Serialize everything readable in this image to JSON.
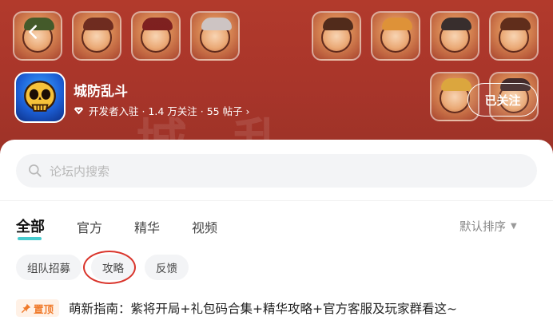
{
  "header": {
    "game_name": "城防乱斗",
    "meta": "开发者入驻 · 1.4 万关注 · 55 帖子 ›",
    "follow_label": "已关注",
    "bg_color": "#a8352a"
  },
  "search": {
    "placeholder": "论坛内搜索"
  },
  "tabs": [
    {
      "label": "全部",
      "active": true
    },
    {
      "label": "官方",
      "active": false
    },
    {
      "label": "精华",
      "active": false
    },
    {
      "label": "视频",
      "active": false
    }
  ],
  "sort": {
    "label": "默认排序"
  },
  "chips": [
    {
      "label": "组队招募"
    },
    {
      "label": "攻略"
    },
    {
      "label": "反馈"
    }
  ],
  "pinned": {
    "badge": "置顶",
    "title": "萌新指南：紫将开局+礼包码合集+精华攻略+官方客服及玩家群看这~"
  },
  "colors": {
    "accent": "#27c2c6",
    "pin_orange": "#f07a2a",
    "highlight_ring": "#d9342b"
  }
}
